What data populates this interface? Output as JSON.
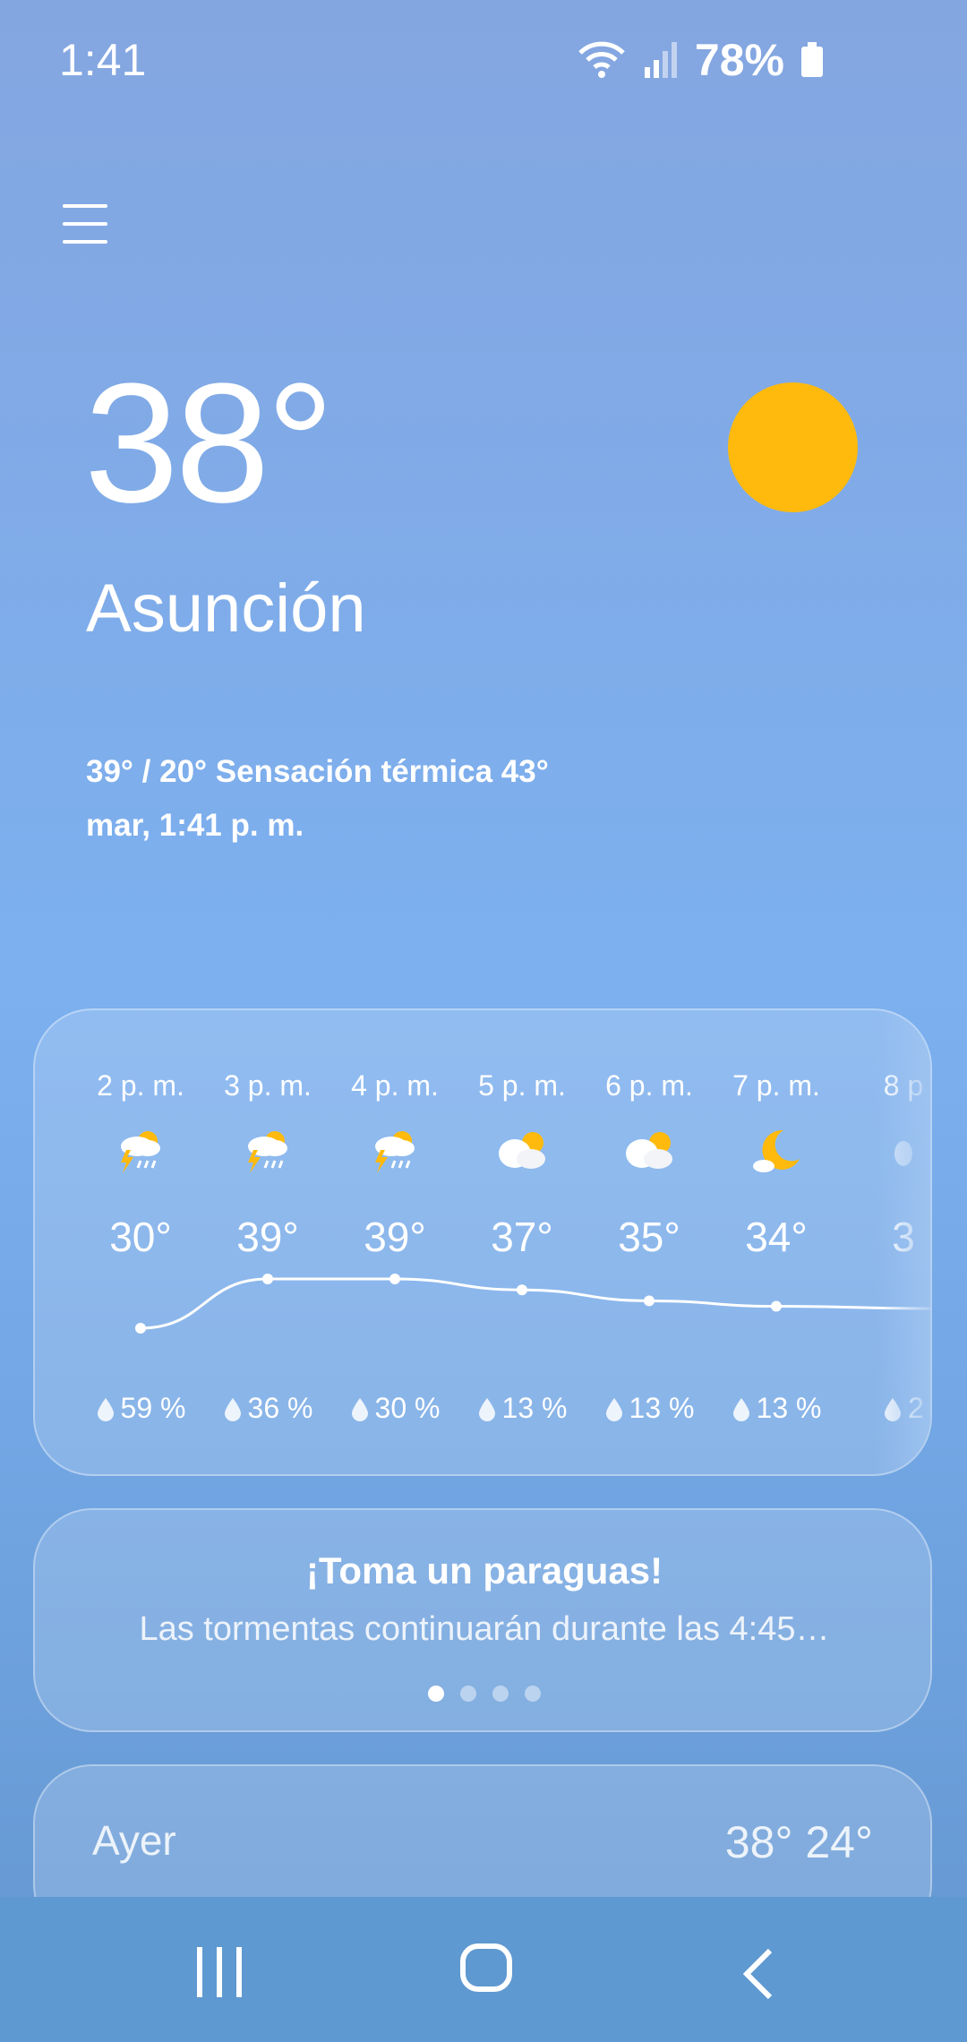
{
  "status_bar": {
    "time": "1:41",
    "battery": "78%"
  },
  "current": {
    "temperature": "38°",
    "city": "Asunción",
    "details_line": "39° / 20° Sensación térmica 43°",
    "datetime_line": "mar, 1:41 p. m.",
    "icon": "sun-icon"
  },
  "hourly": [
    {
      "hour": "2 p. m.",
      "icon": "thunderstorm-icon",
      "temp": "30°",
      "precip": "59 %"
    },
    {
      "hour": "3 p. m.",
      "icon": "thunderstorm-icon",
      "temp": "39°",
      "precip": "36 %"
    },
    {
      "hour": "4 p. m.",
      "icon": "thunderstorm-icon",
      "temp": "39°",
      "precip": "30 %"
    },
    {
      "hour": "5 p. m.",
      "icon": "partly-cloudy-icon",
      "temp": "37°",
      "precip": "13 %"
    },
    {
      "hour": "6 p. m.",
      "icon": "partly-cloudy-icon",
      "temp": "35°",
      "precip": "13 %"
    },
    {
      "hour": "7 p. m.",
      "icon": "moon-icon",
      "temp": "34°",
      "precip": "13 %"
    },
    {
      "hour": "8 p",
      "icon": "night-icon",
      "temp": "3",
      "precip": "2"
    }
  ],
  "chart_data": {
    "type": "line",
    "categories": [
      "2 p. m.",
      "3 p. m.",
      "4 p. m.",
      "5 p. m.",
      "6 p. m.",
      "7 p. m."
    ],
    "values": [
      30,
      39,
      39,
      37,
      35,
      34
    ]
  },
  "tip": {
    "title": "¡Toma un paraguas!",
    "text": "Las tormentas continuarán durante las 4:45…",
    "page_count": 4,
    "active_page": 0
  },
  "yesterday": {
    "label": "Ayer",
    "temps": "38° 24°"
  },
  "colors": {
    "sun": "#ffba0d",
    "cloud": "#ffffff",
    "background_top": "#84a6e0",
    "background_bottom": "#6497d0"
  }
}
